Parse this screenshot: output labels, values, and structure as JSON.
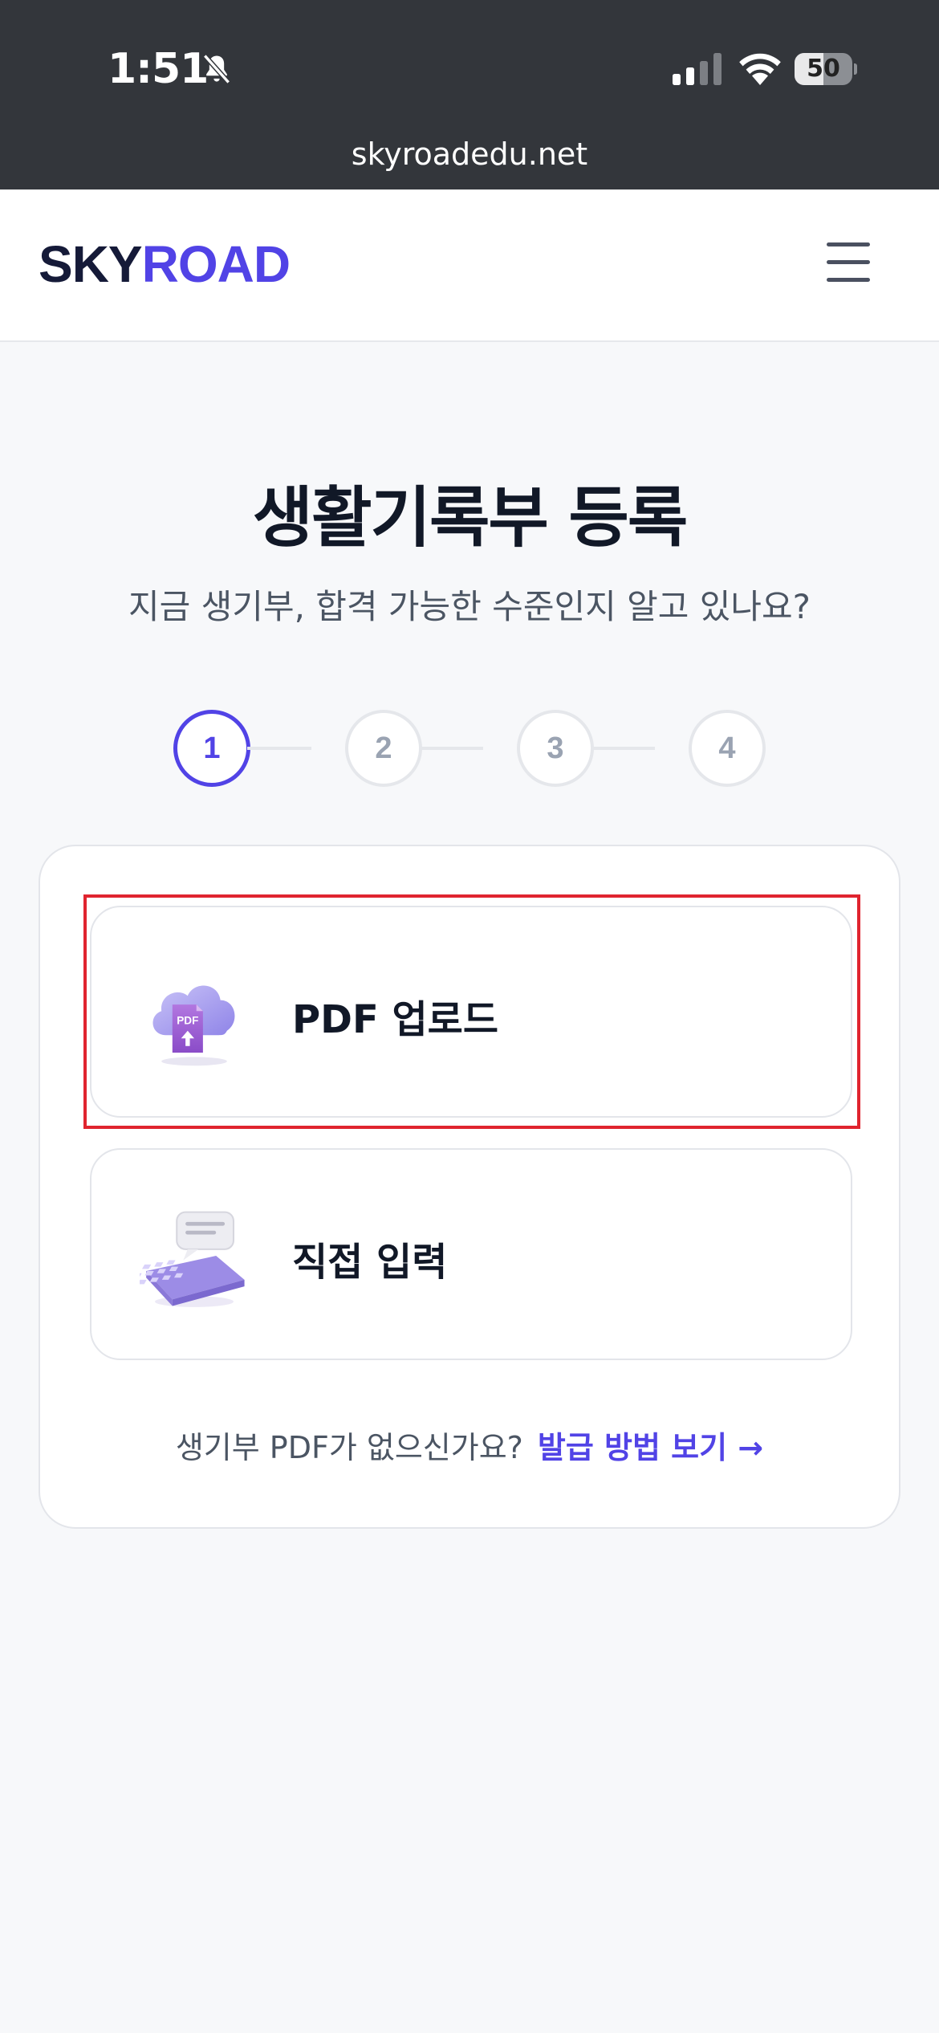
{
  "status_bar": {
    "time": "1:51",
    "battery": "50",
    "battery_level": 0.5,
    "url": "skyroadedu.net",
    "icons": [
      "bell-slash-icon",
      "cellular-signal-icon",
      "wifi-icon",
      "battery-icon"
    ]
  },
  "header": {
    "logo_part1": "SKY",
    "logo_part2": "ROAD",
    "menu_icon": "hamburger-menu-icon"
  },
  "main": {
    "title": "생활기록부 등록",
    "subtitle": "지금 생기부, 합격 가능한 수준인지 알고 있나요?"
  },
  "stepper": {
    "steps": [
      "1",
      "2",
      "3",
      "4"
    ],
    "active_step": 1
  },
  "options": {
    "pdf": {
      "label": "PDF 업로드",
      "icon": "cloud-pdf-upload-icon"
    },
    "manual": {
      "label": "직접 입력",
      "icon": "keyboard-icon"
    }
  },
  "footer": {
    "question": "생기부 PDF가 없으신가요?",
    "link": "발급 방법 보기 →"
  },
  "colors": {
    "accent": "#5143e6",
    "dark_text": "#111827",
    "status_bar_bg": "#33363b",
    "highlight_border": "#e0242f"
  }
}
